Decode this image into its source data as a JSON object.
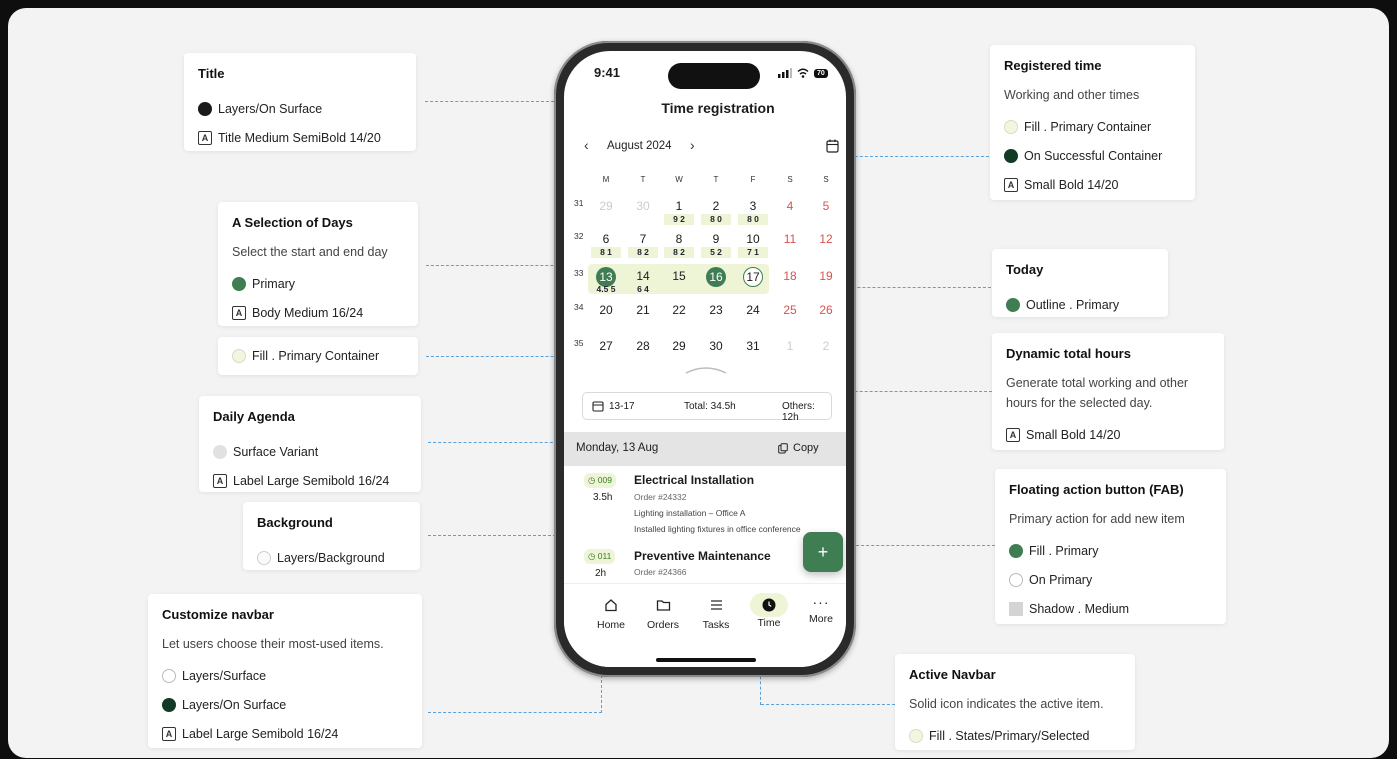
{
  "phone": {
    "status_time": "9:41",
    "battery": "70",
    "title": "Time registration",
    "month": "August 2024",
    "weekdays": [
      "M",
      "T",
      "W",
      "T",
      "F",
      "S",
      "S"
    ],
    "weeks": [
      {
        "num": "31",
        "days": [
          "29",
          "30",
          "1",
          "2",
          "3",
          "4",
          "5"
        ],
        "hours": [
          "",
          "",
          "9 2",
          "8 0",
          "8 0",
          "",
          ""
        ]
      },
      {
        "num": "32",
        "days": [
          "6",
          "7",
          "8",
          "9",
          "10",
          "11",
          "12"
        ],
        "hours": [
          "8 1",
          "8 2",
          "8 2",
          "5 2",
          "7 1",
          "",
          ""
        ]
      },
      {
        "num": "33",
        "days": [
          "13",
          "14",
          "15",
          "16",
          "17",
          "18",
          "19"
        ],
        "hours": [
          "4.5 5",
          "6 4",
          "",
          "",
          "",
          "",
          ""
        ]
      },
      {
        "num": "34",
        "days": [
          "20",
          "21",
          "22",
          "23",
          "24",
          "25",
          "26"
        ],
        "hours": [
          "",
          "",
          "",
          "",
          "",
          "",
          ""
        ]
      },
      {
        "num": "35",
        "days": [
          "27",
          "28",
          "29",
          "30",
          "31",
          "1",
          "2"
        ],
        "hours": [
          "",
          "",
          "",
          "",
          "",
          "",
          ""
        ]
      }
    ],
    "summary": {
      "range": "13-17",
      "total": "Total: 34.5h",
      "others": "Others: 12h"
    },
    "agenda_header": {
      "date": "Monday, 13 Aug",
      "copy": "Copy"
    },
    "agenda": [
      {
        "code": "009",
        "hours": "3.5h",
        "title": "Electrical Installation",
        "order": "Order #24332",
        "line1": "Lighting installation – Office A",
        "line2": "Installed lighting fixtures in office conference"
      },
      {
        "code": "011",
        "hours": "2h",
        "title": "Preventive Maintenance",
        "order": "Order #24366"
      }
    ],
    "fab": "+",
    "nav": [
      {
        "label": "Home",
        "icon": "home-icon"
      },
      {
        "label": "Orders",
        "icon": "folder-icon"
      },
      {
        "label": "Tasks",
        "icon": "list-icon"
      },
      {
        "label": "Time",
        "icon": "clock-icon"
      },
      {
        "label": "More",
        "icon": "more-icon"
      }
    ]
  },
  "annotations": {
    "title": {
      "heading": "Title",
      "color": "Layers/On Surface",
      "type": "Title Medium SemiBold 14/20"
    },
    "selection": {
      "heading": "A Selection of Days",
      "desc": "Select the start and end day",
      "color": "Primary",
      "type": "Body Medium 16/24"
    },
    "fill_container": {
      "color": "Fill . Primary Container"
    },
    "daily_agenda": {
      "heading": "Daily Agenda",
      "color": "Surface Variant",
      "type": "Label Large Semibold 16/24"
    },
    "background": {
      "heading": "Background",
      "color": "Layers/Background"
    },
    "navbar": {
      "heading": "Customize navbar",
      "desc": "Let users choose their most-used items.",
      "color1": "Layers/Surface",
      "color2": "Layers/On Surface",
      "type": "Label Large Semibold 16/24"
    },
    "registered": {
      "heading": "Registered time",
      "desc": "Working and other times",
      "color1": "Fill . Primary Container",
      "color2": "On Successful Container",
      "type": "Small Bold 14/20"
    },
    "today": {
      "heading": "Today",
      "color": "Outline . Primary"
    },
    "dynamic": {
      "heading": "Dynamic total hours",
      "desc1": "Generate total working and other",
      "desc2": "hours for the selected day.",
      "type": "Small Bold 14/20"
    },
    "fab": {
      "heading": "Floating action button (FAB)",
      "desc": "Primary action for add new item",
      "color1": "Fill . Primary",
      "color2": "On Primary",
      "shadow": "Shadow . Medium"
    },
    "active": {
      "heading": "Active Navbar",
      "desc": "Solid icon indicates the active item.",
      "color": "Fill . States/Primary/Selected"
    },
    "type_icon": "A"
  },
  "colors": {
    "primary": "#3f7d52",
    "primary_container": "#eef5d6",
    "on_surface": "#1a1a1a",
    "success_container": "#123a24",
    "weekend": "#d9534f",
    "connector": "#5aa1dc"
  }
}
